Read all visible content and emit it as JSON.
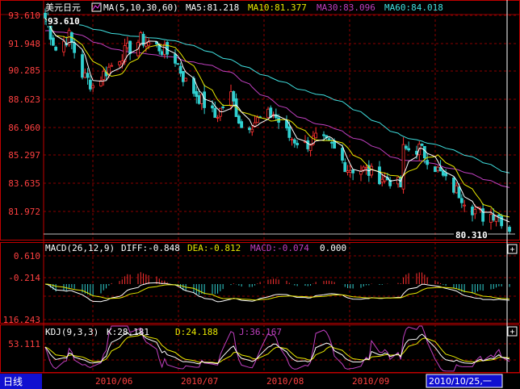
{
  "colors": {
    "bg": "#000000",
    "grid": "#8b0000",
    "border": "#c00000",
    "axis_text": "#ff4040",
    "white": "#ffffff",
    "yellow": "#e8e800",
    "magenta": "#c040c0",
    "cyan": "#40e0e0",
    "up": "#ff3030",
    "down": "#30d0d0",
    "status_bg": "#1010d0"
  },
  "header": {
    "title": "美元日元",
    "ma_label": "MA(5,10,30,60)",
    "ma5": "MA5:81.218",
    "ma10": "MA10:81.377",
    "ma30": "MA30:83.096",
    "ma60": "MA60:84.018"
  },
  "macd_header": {
    "label": "MACD(26,12,9)",
    "diff": "DIFF:-0.848",
    "dea": "DEA:-0.812",
    "macd": "MACD:-0.074",
    "extra": "0.000"
  },
  "kdj_header": {
    "label": "KDJ(9,3,3)",
    "k": "K:28.181",
    "d": "D:24.188",
    "j": "J:36.167"
  },
  "axis": {
    "price_ticks": [
      "93.610",
      "91.948",
      "90.285",
      "88.623",
      "86.960",
      "85.297",
      "83.635",
      "81.972"
    ],
    "macd_ticks": [
      "0.610",
      "-0.214"
    ],
    "kdj_ticks": [
      "116.243",
      "53.111"
    ],
    "date_ticks": [
      "2010/06",
      "2010/07",
      "2010/08",
      "2010/09"
    ]
  },
  "annotations": {
    "high": "93.610",
    "low": "80.310"
  },
  "status": {
    "period": "日线",
    "date": "2010/10/25,一"
  },
  "icons": {
    "expand1": "+",
    "expand2": "+"
  },
  "chart_data": {
    "type": "candlestick",
    "title": "美元日元",
    "x_range": [
      "2010-05-03",
      "2010-10-25"
    ],
    "ylim": [
      80.31,
      93.61
    ],
    "close_path": [
      [
        "2010-05-03",
        93.4
      ],
      [
        "2010-05-07",
        91.5
      ],
      [
        "2010-05-12",
        92.3
      ],
      [
        "2010-05-17",
        90.0
      ],
      [
        "2010-05-21",
        89.3
      ],
      [
        "2010-05-26",
        90.2
      ],
      [
        "2010-06-01",
        91.2
      ],
      [
        "2010-06-08",
        92.1
      ],
      [
        "2010-06-15",
        91.6
      ],
      [
        "2010-06-21",
        90.9
      ],
      [
        "2010-06-25",
        89.5
      ],
      [
        "2010-06-30",
        88.6
      ],
      [
        "2010-07-06",
        87.4
      ],
      [
        "2010-07-12",
        88.7
      ],
      [
        "2010-07-16",
        86.8
      ],
      [
        "2010-07-22",
        87.2
      ],
      [
        "2010-07-28",
        87.6
      ],
      [
        "2010-08-03",
        86.2
      ],
      [
        "2010-08-09",
        85.7
      ],
      [
        "2010-08-13",
        86.1
      ],
      [
        "2010-08-19",
        85.6
      ],
      [
        "2010-08-25",
        84.3
      ],
      [
        "2010-08-31",
        84.2
      ],
      [
        "2010-09-06",
        83.8
      ],
      [
        "2010-09-10",
        83.6
      ],
      [
        "2010-09-14",
        83.2
      ],
      [
        "2010-09-15",
        85.4
      ],
      [
        "2010-09-21",
        85.5
      ],
      [
        "2010-09-27",
        84.4
      ],
      [
        "2010-10-01",
        83.5
      ],
      [
        "2010-10-06",
        82.8
      ],
      [
        "2010-10-11",
        81.9
      ],
      [
        "2010-10-15",
        81.4
      ],
      [
        "2010-10-20",
        81.6
      ],
      [
        "2010-10-25",
        80.6
      ]
    ],
    "series": [
      {
        "name": "MA5",
        "last": 81.218
      },
      {
        "name": "MA10",
        "last": 81.377
      },
      {
        "name": "MA30",
        "last": 83.096
      },
      {
        "name": "MA60",
        "last": 84.018
      }
    ],
    "macd": {
      "diff": -0.848,
      "dea": -0.812,
      "macd": -0.074,
      "ylim": [
        -0.214,
        0.61
      ]
    },
    "kdj": {
      "k": 28.181,
      "d": 24.188,
      "j": 36.167,
      "ticks": [
        116.243,
        53.111
      ]
    }
  }
}
